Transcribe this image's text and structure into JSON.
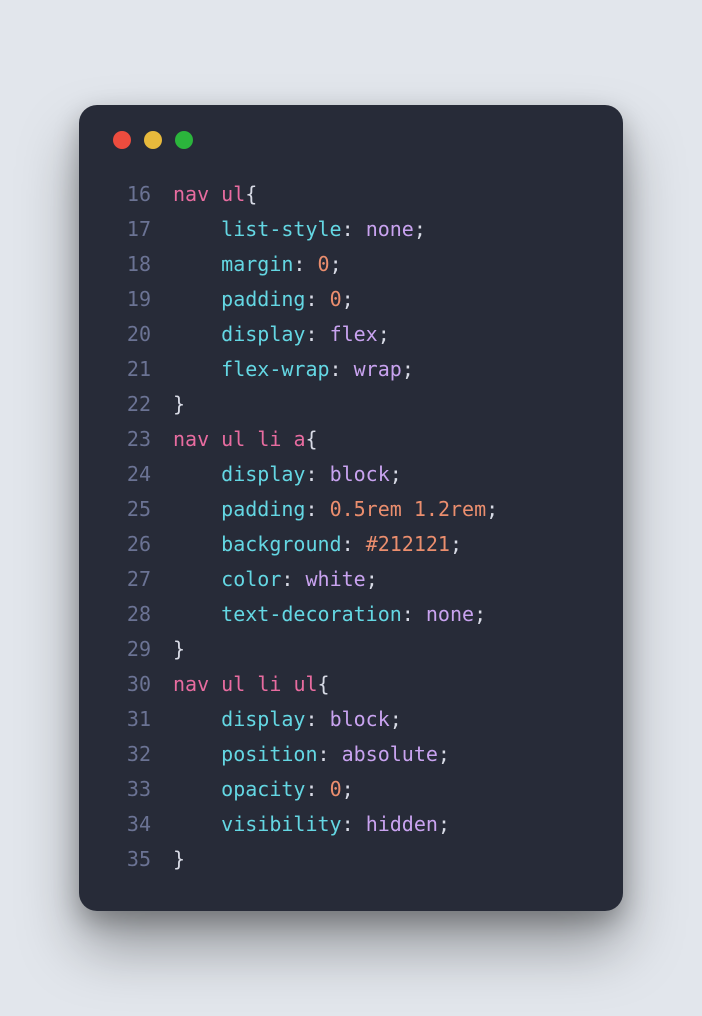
{
  "dots": [
    "red",
    "yellow",
    "green"
  ],
  "colors": {
    "bg_page": "#e2e6ec",
    "bg_window": "#272b38",
    "tag": "#e86ca0",
    "prop": "#64d7e3",
    "val": "#c9a3f0",
    "num": "#eb8e6e",
    "punc": "#d8dbe6",
    "ln": "#6b7394"
  },
  "lines": [
    {
      "n": "16",
      "indent": 0,
      "tokens": [
        {
          "c": "tag",
          "t": "nav"
        },
        {
          "c": "punc",
          "t": " "
        },
        {
          "c": "tag",
          "t": "ul"
        },
        {
          "c": "punc",
          "t": "{"
        }
      ]
    },
    {
      "n": "17",
      "indent": 1,
      "tokens": [
        {
          "c": "prop",
          "t": "list-style"
        },
        {
          "c": "punc",
          "t": ": "
        },
        {
          "c": "val",
          "t": "none"
        },
        {
          "c": "punc",
          "t": ";"
        }
      ]
    },
    {
      "n": "18",
      "indent": 1,
      "tokens": [
        {
          "c": "prop",
          "t": "margin"
        },
        {
          "c": "punc",
          "t": ": "
        },
        {
          "c": "num",
          "t": "0"
        },
        {
          "c": "punc",
          "t": ";"
        }
      ]
    },
    {
      "n": "19",
      "indent": 1,
      "tokens": [
        {
          "c": "prop",
          "t": "padding"
        },
        {
          "c": "punc",
          "t": ": "
        },
        {
          "c": "num",
          "t": "0"
        },
        {
          "c": "punc",
          "t": ";"
        }
      ]
    },
    {
      "n": "20",
      "indent": 1,
      "tokens": [
        {
          "c": "prop",
          "t": "display"
        },
        {
          "c": "punc",
          "t": ": "
        },
        {
          "c": "val",
          "t": "flex"
        },
        {
          "c": "punc",
          "t": ";"
        }
      ]
    },
    {
      "n": "21",
      "indent": 1,
      "tokens": [
        {
          "c": "prop",
          "t": "flex-wrap"
        },
        {
          "c": "punc",
          "t": ": "
        },
        {
          "c": "val",
          "t": "wrap"
        },
        {
          "c": "punc",
          "t": ";"
        }
      ]
    },
    {
      "n": "22",
      "indent": 0,
      "tokens": [
        {
          "c": "punc",
          "t": "}"
        }
      ]
    },
    {
      "n": "23",
      "indent": 0,
      "tokens": [
        {
          "c": "tag",
          "t": "nav"
        },
        {
          "c": "punc",
          "t": " "
        },
        {
          "c": "tag",
          "t": "ul"
        },
        {
          "c": "punc",
          "t": " "
        },
        {
          "c": "tag",
          "t": "li"
        },
        {
          "c": "punc",
          "t": " "
        },
        {
          "c": "tag",
          "t": "a"
        },
        {
          "c": "punc",
          "t": "{"
        }
      ]
    },
    {
      "n": "24",
      "indent": 1,
      "tokens": [
        {
          "c": "prop",
          "t": "display"
        },
        {
          "c": "punc",
          "t": ": "
        },
        {
          "c": "val",
          "t": "block"
        },
        {
          "c": "punc",
          "t": ";"
        }
      ]
    },
    {
      "n": "25",
      "indent": 1,
      "tokens": [
        {
          "c": "prop",
          "t": "padding"
        },
        {
          "c": "punc",
          "t": ": "
        },
        {
          "c": "num",
          "t": "0.5rem"
        },
        {
          "c": "punc",
          "t": " "
        },
        {
          "c": "num",
          "t": "1.2rem"
        },
        {
          "c": "punc",
          "t": ";"
        }
      ]
    },
    {
      "n": "26",
      "indent": 1,
      "tokens": [
        {
          "c": "prop",
          "t": "background"
        },
        {
          "c": "punc",
          "t": ": "
        },
        {
          "c": "num",
          "t": "#212121"
        },
        {
          "c": "punc",
          "t": ";"
        }
      ]
    },
    {
      "n": "27",
      "indent": 1,
      "tokens": [
        {
          "c": "prop",
          "t": "color"
        },
        {
          "c": "punc",
          "t": ": "
        },
        {
          "c": "val",
          "t": "white"
        },
        {
          "c": "punc",
          "t": ";"
        }
      ]
    },
    {
      "n": "28",
      "indent": 1,
      "tokens": [
        {
          "c": "prop",
          "t": "text-decoration"
        },
        {
          "c": "punc",
          "t": ": "
        },
        {
          "c": "val",
          "t": "none"
        },
        {
          "c": "punc",
          "t": ";"
        }
      ]
    },
    {
      "n": "29",
      "indent": 0,
      "tokens": [
        {
          "c": "punc",
          "t": "}"
        }
      ]
    },
    {
      "n": "30",
      "indent": 0,
      "tokens": [
        {
          "c": "tag",
          "t": "nav"
        },
        {
          "c": "punc",
          "t": " "
        },
        {
          "c": "tag",
          "t": "ul"
        },
        {
          "c": "punc",
          "t": " "
        },
        {
          "c": "tag",
          "t": "li"
        },
        {
          "c": "punc",
          "t": " "
        },
        {
          "c": "tag",
          "t": "ul"
        },
        {
          "c": "punc",
          "t": "{"
        }
      ]
    },
    {
      "n": "31",
      "indent": 1,
      "tokens": [
        {
          "c": "prop",
          "t": "display"
        },
        {
          "c": "punc",
          "t": ": "
        },
        {
          "c": "val",
          "t": "block"
        },
        {
          "c": "punc",
          "t": ";"
        }
      ]
    },
    {
      "n": "32",
      "indent": 1,
      "tokens": [
        {
          "c": "prop",
          "t": "position"
        },
        {
          "c": "punc",
          "t": ": "
        },
        {
          "c": "val",
          "t": "absolute"
        },
        {
          "c": "punc",
          "t": ";"
        }
      ]
    },
    {
      "n": "33",
      "indent": 1,
      "tokens": [
        {
          "c": "prop",
          "t": "opacity"
        },
        {
          "c": "punc",
          "t": ": "
        },
        {
          "c": "num",
          "t": "0"
        },
        {
          "c": "punc",
          "t": ";"
        }
      ]
    },
    {
      "n": "34",
      "indent": 1,
      "tokens": [
        {
          "c": "prop",
          "t": "visibility"
        },
        {
          "c": "punc",
          "t": ": "
        },
        {
          "c": "val",
          "t": "hidden"
        },
        {
          "c": "punc",
          "t": ";"
        }
      ]
    },
    {
      "n": "35",
      "indent": 0,
      "tokens": [
        {
          "c": "punc",
          "t": "}"
        }
      ]
    }
  ]
}
